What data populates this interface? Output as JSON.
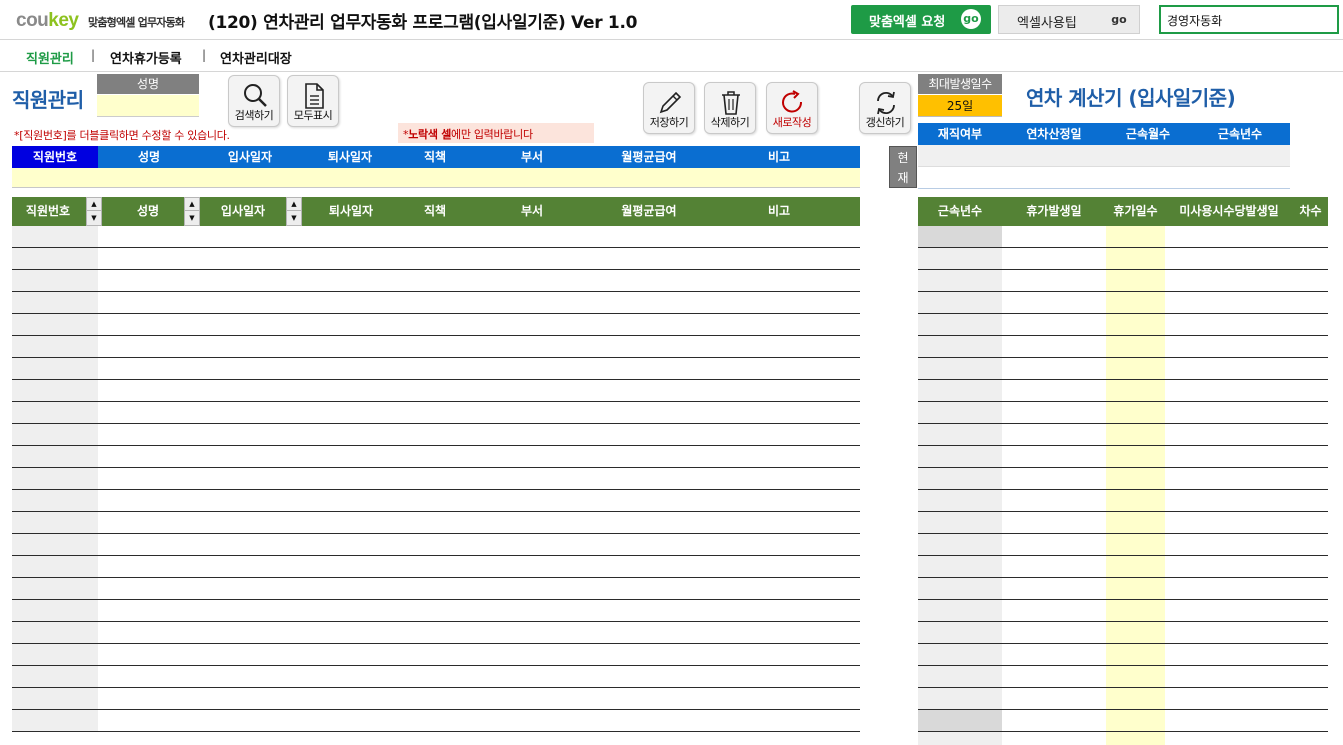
{
  "header": {
    "logo_main": "cou",
    "logo_accent": "key",
    "tagline": "맞춤형엑셀 업무자동화",
    "title": "(120) 연차관리 업무자동화 프로그램(입사일기준) Ver 1.0",
    "request_button": "맞춤엑셀 요청",
    "tip_button": "엑셀사용팁",
    "go_label": "go",
    "search_value": "경영자동화"
  },
  "tabs": [
    {
      "label": "직원관리",
      "active": true
    },
    {
      "label": "연차휴가등록",
      "active": false
    },
    {
      "label": "연차관리대장",
      "active": false
    }
  ],
  "tab_separator": "|",
  "left": {
    "section_title": "직원관리",
    "name_label": "성명",
    "buttons": {
      "search": "검색하기",
      "show_all": "모두표시",
      "save": "저장하기",
      "delete": "삭제하기",
      "new": "새로작성"
    },
    "note_edit": "*[직원번호]를 더블클릭하면 수정할 수 있습니다.",
    "note_input_prefix": "*",
    "note_input_bold": "노락색 셀",
    "note_input_rest": "에만 입력바랍니다",
    "form_columns": [
      "직원번호",
      "성명",
      "입사일자",
      "퇴사일자",
      "직책",
      "부서",
      "월평균급여",
      "비고"
    ],
    "list_columns": [
      "직원번호",
      "성명",
      "입사일자",
      "퇴사일자",
      "직책",
      "부서",
      "월평균급여",
      "비고"
    ]
  },
  "right": {
    "refresh_button": "갱신하기",
    "max_label": "최대발생일수",
    "max_value": "25일",
    "calc_title": "연차 계산기 (입사일기준)",
    "current_tag_1": "현",
    "current_tag_2": "재",
    "status_columns": [
      "재직여부",
      "연차산정일",
      "근속월수",
      "근속년수"
    ],
    "table_columns": [
      "근속년수",
      "휴가발생일",
      "휴가일수",
      "미사용시수당발생일",
      "차수"
    ]
  },
  "colors": {
    "brand_green": "#1e9b46",
    "header_blue": "#0a6ed1",
    "header_green": "#548235",
    "input_yellow": "#ffffcc",
    "title_blue": "#1f5ea8",
    "alert_red": "#c00000"
  },
  "icons": [
    "search-icon",
    "document-icon",
    "pencil-icon",
    "trash-icon",
    "refresh-circle-icon",
    "sync-icon",
    "sort-up-icon",
    "sort-down-icon"
  ]
}
